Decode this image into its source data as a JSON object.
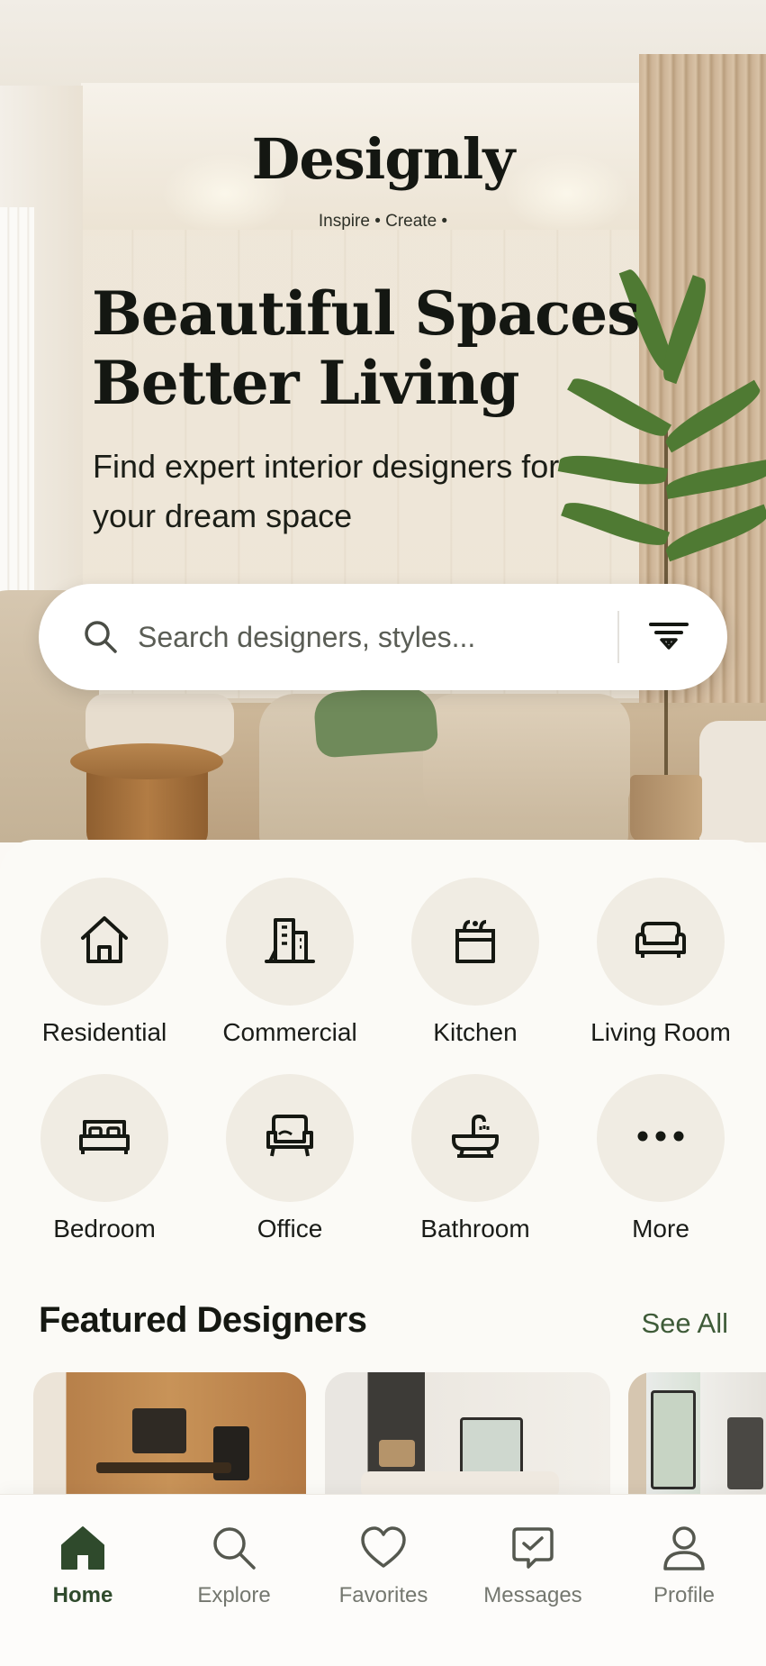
{
  "brand": {
    "name": "Designly",
    "tagline": "Inspire • Create •"
  },
  "hero": {
    "headline_line1": "Beautiful Spaces",
    "headline_line2": "Better Living",
    "subheadline": "Find expert interior designers for your dream space"
  },
  "search": {
    "placeholder": "Search designers, styles...",
    "value": "",
    "search_icon": "search-icon",
    "filter_icon": "filter-icon"
  },
  "categories": [
    {
      "label": "Residential",
      "icon": "house-icon"
    },
    {
      "label": "Commercial",
      "icon": "building-icon"
    },
    {
      "label": "Kitchen",
      "icon": "kitchen-icon"
    },
    {
      "label": "Living Room",
      "icon": "sofa-icon"
    },
    {
      "label": "Bedroom",
      "icon": "bed-icon"
    },
    {
      "label": "Office",
      "icon": "office-chair-icon"
    },
    {
      "label": "Bathroom",
      "icon": "bathtub-icon"
    },
    {
      "label": "More",
      "icon": "more-dots-icon"
    }
  ],
  "featured": {
    "title": "Featured Designers",
    "see_all": "See All"
  },
  "bottom_nav": [
    {
      "label": "Home",
      "icon": "home-icon",
      "active": true
    },
    {
      "label": "Explore",
      "icon": "search-icon",
      "active": false
    },
    {
      "label": "Favorites",
      "icon": "heart-icon",
      "active": false
    },
    {
      "label": "Messages",
      "icon": "message-icon",
      "active": false
    },
    {
      "label": "Profile",
      "icon": "profile-icon",
      "active": false
    }
  ],
  "colors": {
    "accent_green": "#2f4a2c",
    "link_green": "#3e5b38",
    "category_circle": "#f0ece3",
    "background": "#fbfaf6",
    "inactive_nav": "#74776f"
  }
}
